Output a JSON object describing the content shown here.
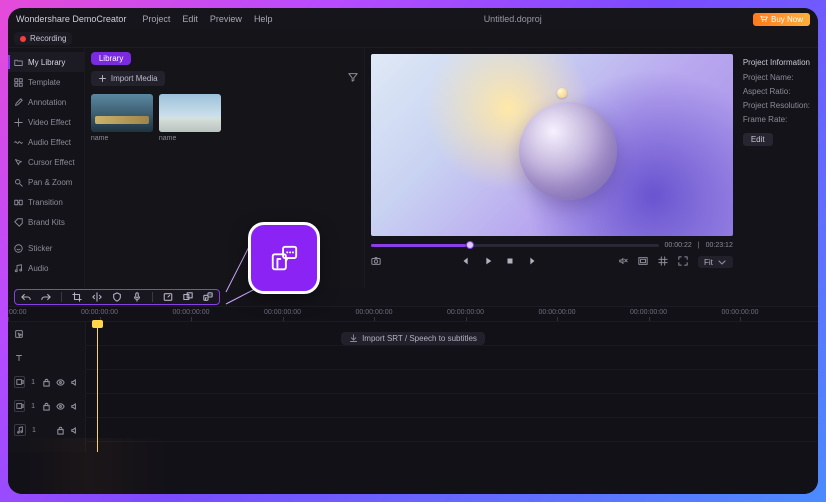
{
  "app": {
    "brand": "Wondershare DemoCreator",
    "project_filename": "Untitled.doproj",
    "buy_label": "Buy Now"
  },
  "menu": {
    "project": "Project",
    "edit": "Edit",
    "preview": "Preview",
    "help": "Help"
  },
  "recording": {
    "label": "Recording"
  },
  "sidebar": {
    "items": [
      "My Library",
      "Template",
      "Annotation",
      "Video Effect",
      "Audio Effect",
      "Cursor Effect",
      "Pan & Zoom",
      "Transition",
      "Brand Kits",
      "Sticker",
      "Audio"
    ]
  },
  "library": {
    "chip": "Library",
    "import_label": "Import Media",
    "thumbs": [
      {
        "caption": "name"
      },
      {
        "caption": "name"
      }
    ]
  },
  "preview": {
    "time_current": "00:00:22",
    "time_total": "00:23:12",
    "fit_label": "Fit",
    "progress_pct": 33
  },
  "info": {
    "heading": "Project Information",
    "project_name_label": "Project Name:",
    "aspect_ratio_label": "Aspect Ratio:",
    "resolution_label": "Project Resolution:",
    "frame_rate_label": "Frame Rate:",
    "edit_label": "Edit"
  },
  "timeline": {
    "labels": [
      "00:00:00:00",
      "00:00:00:00",
      "00:00:00:00",
      "00:00:00:00",
      "00:00:00:00",
      "00:00:00:00",
      "00:00:00:00",
      "00:00:00:00",
      "00:00:00:00"
    ],
    "srt_label": "Import SRT / Speech to subtitles",
    "tracks": {
      "cam1": "1",
      "cam2": "1",
      "audio1": "1"
    },
    "playhead_pct": 1.5
  }
}
